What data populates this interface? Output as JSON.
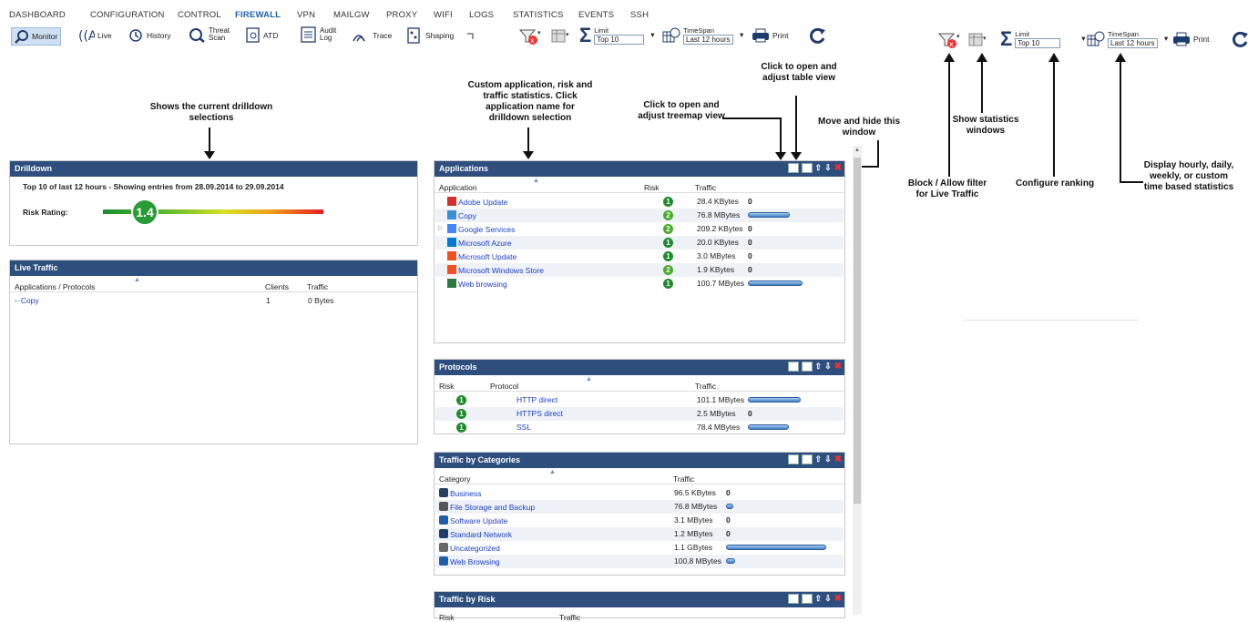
{
  "nav": [
    "DASHBOARD",
    "CONFIGURATION",
    "CONTROL",
    "FIREWALL",
    "VPN",
    "MAILGW",
    "PROXY",
    "WIFI",
    "LOGS",
    "STATISTICS",
    "EVENTS",
    "SSH"
  ],
  "toolbar": {
    "monitor": "Monitor",
    "live": "Live",
    "history": "History",
    "threat1": "Threat",
    "threat2": "Scan",
    "atd": "ATD",
    "audit1": "Audit",
    "audit2": "Log",
    "trace": "Trace",
    "shaping": "Shaping",
    "limit_caption": "Limit",
    "limit_value": "Top 10",
    "timespan_caption": "TimeSpan",
    "timespan_value": "Last 12 hours",
    "print": "Print"
  },
  "drilldown": {
    "title": "Drilldown",
    "summary": "Top 10 of last 12 hours - Showing entries from 28.09.2014 to 29.09.2014",
    "risk_label": "Risk Rating:",
    "risk_value": "1.4"
  },
  "live_traffic": {
    "title": "Live Traffic",
    "columns": [
      "Applications / Protocols",
      "Clients",
      "Traffic"
    ],
    "rows": [
      {
        "name": "Copy",
        "clients": "1",
        "traffic": "0 Bytes"
      }
    ]
  },
  "applications": {
    "title": "Applications",
    "columns": [
      "Application",
      "Risk",
      "Traffic"
    ],
    "rows": [
      {
        "name": "Adobe Update",
        "risk": "1",
        "traffic": "28.4 KBytes",
        "bar": 0
      },
      {
        "name": "Copy",
        "risk": "2",
        "traffic": "76.8 MBytes",
        "bar": 0.76
      },
      {
        "name": "Google Services",
        "risk": "2",
        "traffic": "209.2 KBytes",
        "bar": 0
      },
      {
        "name": "Microsoft Azure",
        "risk": "1",
        "traffic": "20.0 KBytes",
        "bar": 0
      },
      {
        "name": "Microsoft Update",
        "risk": "1",
        "traffic": "3.0 MBytes",
        "bar": 0
      },
      {
        "name": "Microsoft Windows Store",
        "risk": "2",
        "traffic": "1.9 KBytes",
        "bar": 0
      },
      {
        "name": "Web browsing",
        "risk": "1",
        "traffic": "100.7 MBytes",
        "bar": 1.0
      }
    ]
  },
  "protocols": {
    "title": "Protocols",
    "columns": [
      "Risk",
      "Protocol",
      "Traffic"
    ],
    "rows": [
      {
        "risk": "1",
        "name": "HTTP direct",
        "traffic": "101.1 MBytes",
        "bar": 1.0
      },
      {
        "risk": "1",
        "name": "HTTPS direct",
        "traffic": "2.5 MBytes",
        "bar": 0
      },
      {
        "risk": "1",
        "name": "SSL",
        "traffic": "78.4 MBytes",
        "bar": 0.78
      }
    ]
  },
  "categories": {
    "title": "Traffic by Categories",
    "columns": [
      "Category",
      "Traffic"
    ],
    "rows": [
      {
        "name": "Business",
        "traffic": "96.5 KBytes",
        "bar": 0
      },
      {
        "name": "File Storage and Backup",
        "traffic": "76.8 MBytes",
        "bar": 0.07
      },
      {
        "name": "Software Update",
        "traffic": "3.1 MBytes",
        "bar": 0
      },
      {
        "name": "Standard Network",
        "traffic": "1.2 MBytes",
        "bar": 0
      },
      {
        "name": "Uncategorized",
        "traffic": "1.1 GBytes",
        "bar": 1.0
      },
      {
        "name": "Web Browsing",
        "traffic": "100.8 MBytes",
        "bar": 0.09
      }
    ]
  },
  "risk_panel": {
    "title": "Traffic by Risk",
    "columns": [
      "Risk",
      "Traffic"
    ]
  },
  "annotations": {
    "drilldown": "Shows the current drilldown selections",
    "custom": "Custom application, risk and traffic statistics. Click application name for drilldown selection",
    "treemap": "Click to open and adjust treemap view",
    "table": "Click to open and adjust table view",
    "move": "Move and hide this window",
    "block": "Block / Allow filter for  Live Traffic",
    "stats": "Show statistics windows",
    "ranking": "Configure ranking",
    "display": "Display hourly, daily, weekly, or custom time based statistics"
  },
  "colors": {
    "header": "#2e4e7e",
    "link": "#1a3fc4",
    "risk1": "#1f8a2e",
    "risk2": "#4aab2c"
  }
}
